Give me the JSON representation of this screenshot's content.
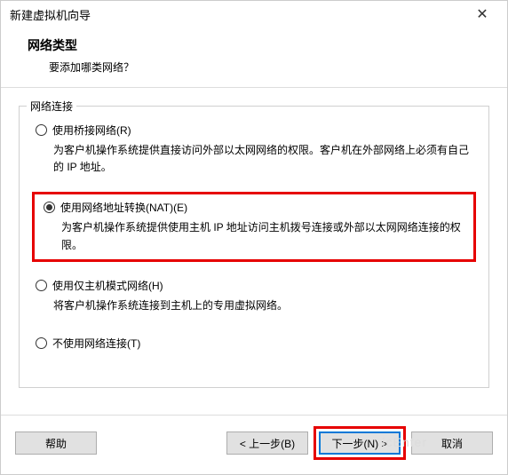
{
  "window": {
    "title": "新建虚拟机向导"
  },
  "header": {
    "title": "网络类型",
    "subtitle": "要添加哪类网络？"
  },
  "group": {
    "legend": "网络连接",
    "options": [
      {
        "label": "使用桥接网络(R)",
        "desc": "为客户机操作系统提供直接访问外部以太网网络的权限。客户机在外部网络上必须有自己的 IP 地址。",
        "checked": false
      },
      {
        "label": "使用网络地址转换(NAT)(E)",
        "desc": "为客户机操作系统提供使用主机 IP 地址访问主机拨号连接或外部以太网网络连接的权限。",
        "checked": true
      },
      {
        "label": "使用仅主机模式网络(H)",
        "desc": "将客户机操作系统连接到主机上的专用虚拟网络。",
        "checked": false
      },
      {
        "label": "不使用网络连接(T)",
        "desc": "",
        "checked": false
      }
    ]
  },
  "footer": {
    "help": "帮助",
    "back": "< 上一步(B)",
    "next": "下一步(N) >",
    "cancel": "取消"
  },
  "watermark": "icEnter"
}
